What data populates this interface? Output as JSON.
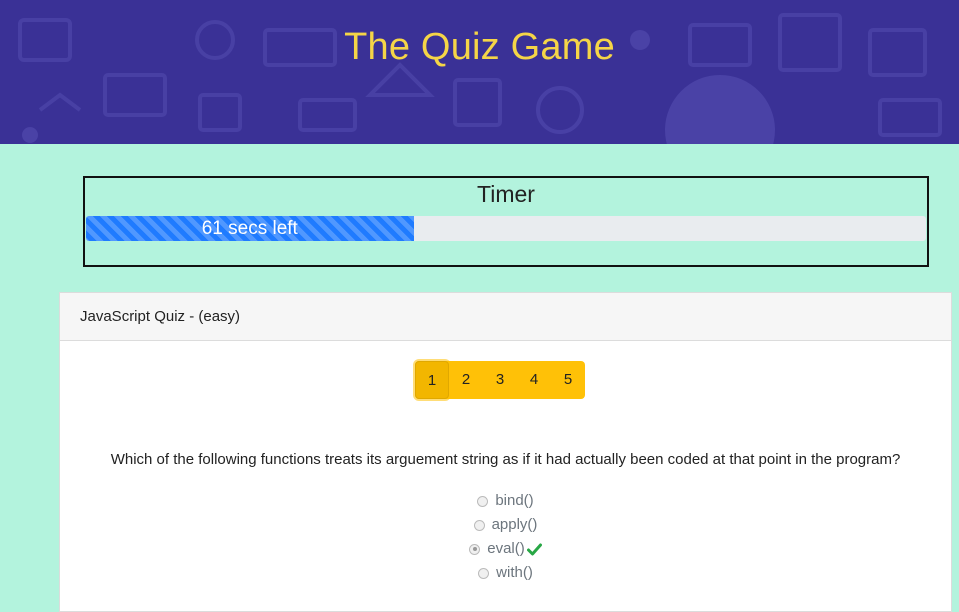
{
  "header": {
    "title": "The Quiz Game"
  },
  "timer": {
    "title": "Timer",
    "label": "61 secs left",
    "progress_fraction": 0.39
  },
  "quiz": {
    "title": "JavaScript Quiz - (easy)",
    "pages": [
      "1",
      "2",
      "3",
      "4",
      "5"
    ],
    "active_page": "1",
    "question": "Which of the following functions treats its arguement string as if it had actually been coded at that point in the program?",
    "options": [
      {
        "label": "bind()",
        "checked": false,
        "correct": false
      },
      {
        "label": "apply()",
        "checked": false,
        "correct": false
      },
      {
        "label": "eval()",
        "checked": true,
        "correct": true
      },
      {
        "label": "with()",
        "checked": false,
        "correct": false
      }
    ]
  },
  "colors": {
    "header_bg": "#3a3196",
    "title": "#f5d547",
    "page_bg": "#b3f3dd",
    "progress": "#1f7bff",
    "pager": "#ffc107",
    "correct": "#28a745"
  },
  "icons": {
    "correct": "check-icon"
  }
}
